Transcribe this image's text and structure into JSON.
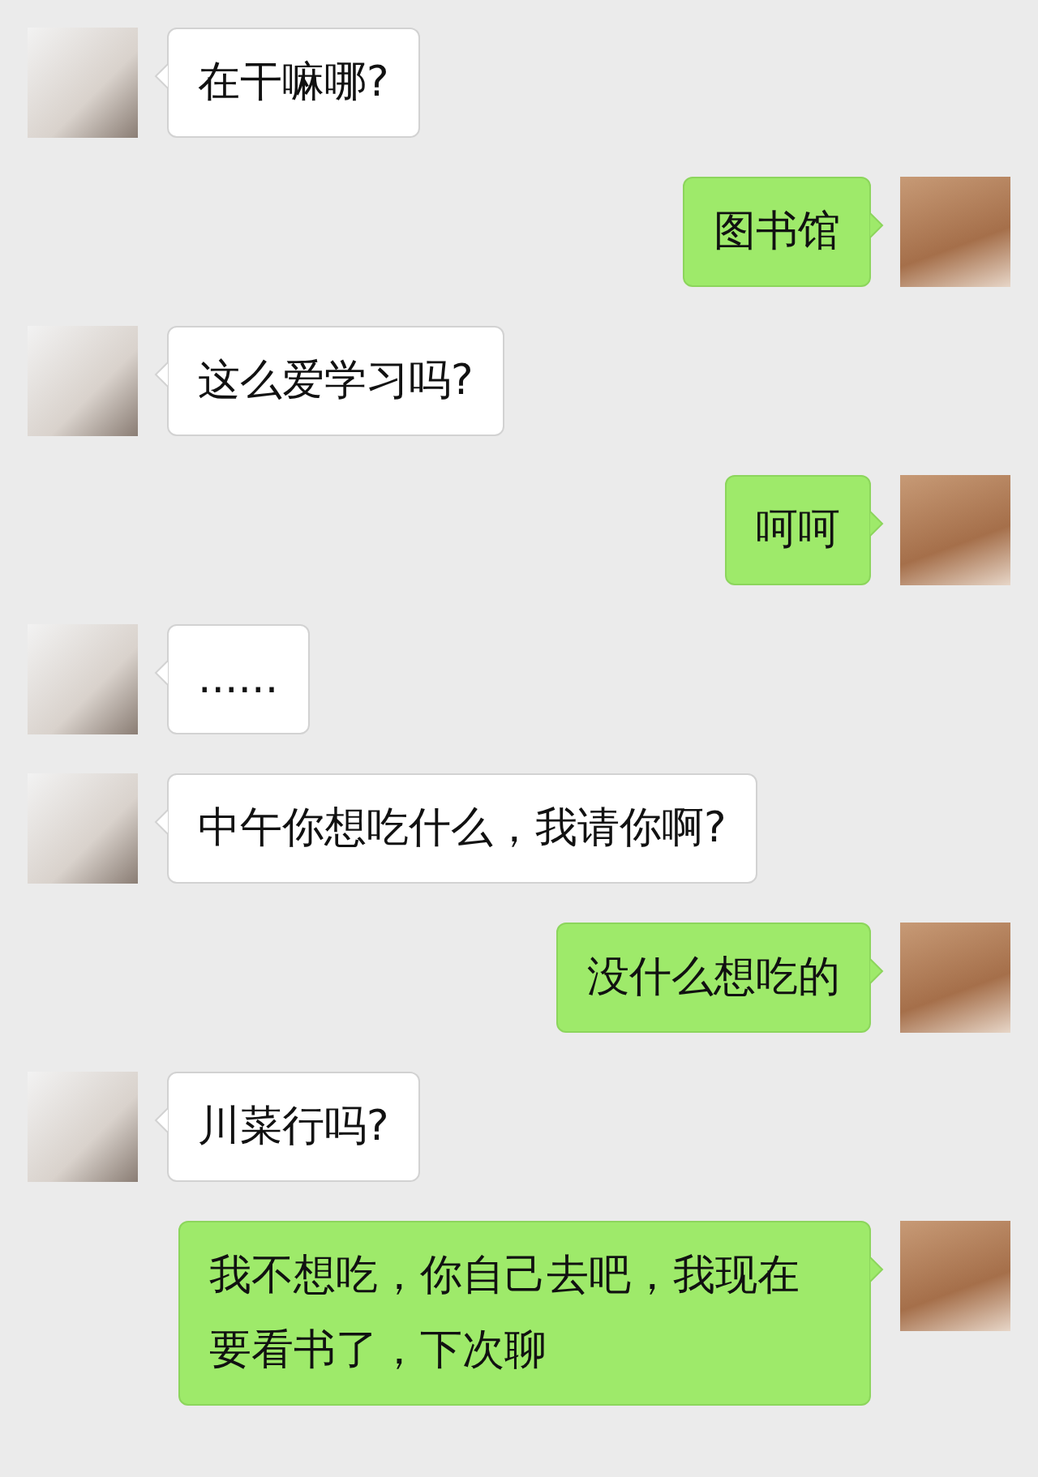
{
  "messages": [
    {
      "kind": "incoming",
      "text": "在干嘛哪?"
    },
    {
      "kind": "outgoing",
      "text": "图书馆"
    },
    {
      "kind": "incoming",
      "text": "这么爱学习吗?"
    },
    {
      "kind": "outgoing",
      "text": "呵呵"
    },
    {
      "kind": "incoming",
      "text": "......"
    },
    {
      "kind": "incoming",
      "text": "中午你想吃什么，我请你啊?"
    },
    {
      "kind": "outgoing",
      "text": "没什么想吃的"
    },
    {
      "kind": "incoming",
      "text": "川菜行吗?"
    },
    {
      "kind": "outgoing",
      "text": "我不想吃，你自己去吧，我现在要看书了，下次聊"
    }
  ]
}
